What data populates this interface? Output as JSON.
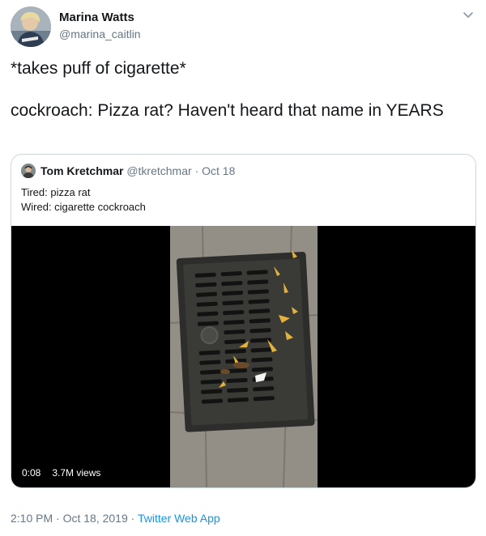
{
  "author": {
    "name": "Marina Watts",
    "handle": "@marina_caitlin"
  },
  "tweet": {
    "line1": "*takes puff of cigarette*",
    "line2": "cockroach: Pizza rat? Haven't heard that name in YEARS"
  },
  "quoted": {
    "name": "Tom Kretchmar",
    "handle": "@tkretchmar",
    "separator": "·",
    "date": "Oct 18",
    "text_line1": "Tired: pizza rat",
    "text_line2": "Wired: cigarette cockroach"
  },
  "video": {
    "duration": "0:08",
    "views": "3.7M views"
  },
  "meta": {
    "time": "2:10 PM",
    "separator1": "·",
    "date": "Oct 18, 2019",
    "separator2": "·",
    "app": "Twitter Web App"
  },
  "icons": {
    "menu": "chevron-down-icon"
  },
  "colors": {
    "text": "#14171a",
    "secondary": "#657786",
    "link": "#1b95e0",
    "border": "#ccd6dd"
  }
}
